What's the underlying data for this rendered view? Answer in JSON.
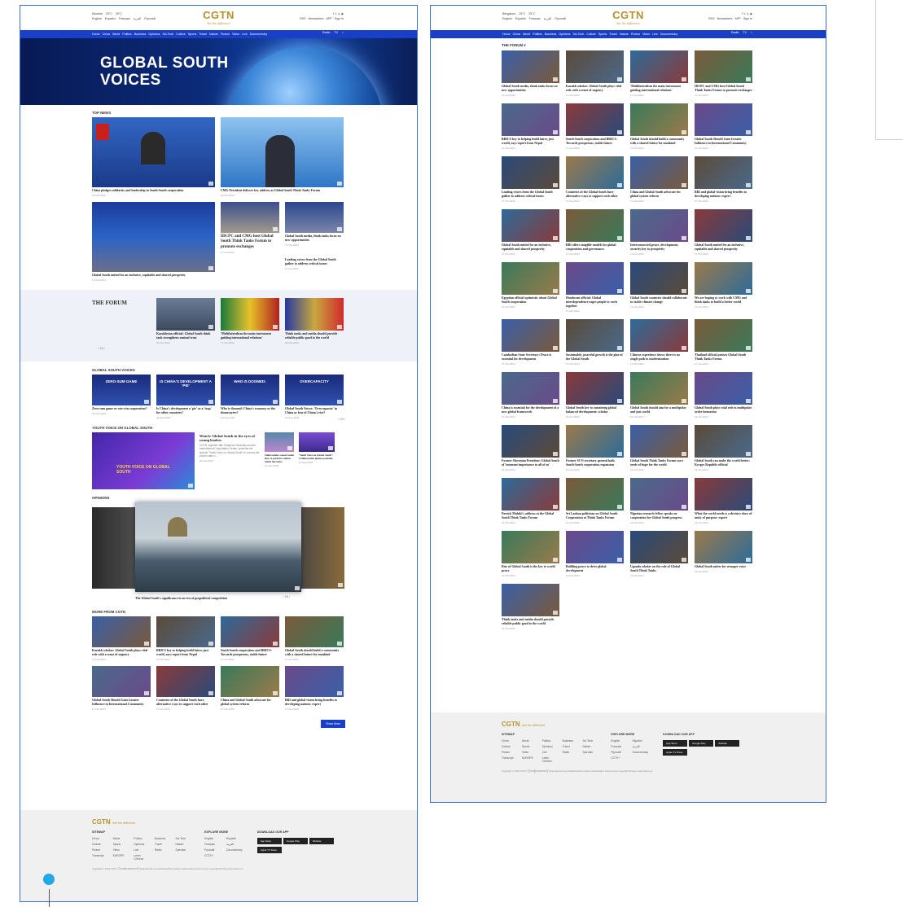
{
  "site": {
    "logo": "CGTN",
    "tagline": "See the difference",
    "weather_a": "Mumbai",
    "weather_b": "Bengaluru",
    "temp1": "25°C",
    "temp2": "25°C",
    "languages": [
      "English",
      "Español",
      "Français",
      "العربية",
      "Русский"
    ],
    "right": "RSS",
    "newsletter": "Newsletters",
    "apps": "APP",
    "login": "Sign In"
  },
  "nav": {
    "items": [
      "Home",
      "China",
      "World",
      "Politics",
      "Business",
      "Opinions",
      "Sci-Tech",
      "Culture",
      "Sports",
      "Travel",
      "Nature",
      "Picture",
      "Video",
      "Live",
      "Documentary"
    ],
    "radio": "Radio",
    "tv": "TV"
  },
  "hero": {
    "line1": "GLOBAL SOUTH",
    "line2": "VOICES"
  },
  "sections": {
    "top_news": "TOP NEWS",
    "forum": "THE FORUM",
    "voices": "GLOBAL SOUTH VOICES",
    "youth": "YOUTH VOICE ON GLOBAL SOUTH",
    "opinions": "OPINIONS",
    "more": "MORE FROM CGTN",
    "forum_b": "THE FORUM"
  },
  "top_news": [
    {
      "title": "China pledges solidarity and leadership in South-South cooperation",
      "date": "24-Oct-2024"
    },
    {
      "title": "CMG President delivers key address at Global South Think Tanks Forum",
      "date": "24-Oct-2024"
    },
    {
      "title": "Global South united for an inclusive, equitable and shared prosperity",
      "date": "17-Oct-2024"
    },
    {
      "title": "IDCPC and CMG host Global South Think Tanks Forum to promote exchanges",
      "date": "17-Oct-2024"
    },
    {
      "title": "Global South media, think tanks focus on new opportunities",
      "date": "17-Oct-2024"
    },
    {
      "title": "Leading voices from the Global South gather to address critical issues",
      "date": "17-Oct-2024"
    }
  ],
  "forum": [
    {
      "title": "Kazakhstan official: Global South think tank strengthens mutual trust",
      "date": "24-Oct-2024"
    },
    {
      "title": "'Multilateralism the main instrument guiding international relations'",
      "date": "17-Oct-2024"
    },
    {
      "title": "Think tanks and media should provide reliable public good to the world",
      "date": "24-Oct-2024"
    }
  ],
  "forum_pager": "1/4",
  "voices": [
    {
      "title": "Zero-sum game or win-win cooperation?",
      "date": "24-Sep-2024",
      "label": "ZERO-SUM GAME"
    },
    {
      "title": "Is China's development a 'pie' or a 'trap' for other countries?",
      "date": "24-Sep-2024",
      "label": "IS CHINA'S DEVELOPMENT A 'PIE'"
    },
    {
      "title": "Who is doomed: China's economy or the doomsayers?",
      "date": "23-Sep-2024",
      "label": "WHO IS DOOMED:"
    },
    {
      "title": "Global South Voices: 'Overcapacity' in China or fear of China's rise?",
      "date": "20-Sep-2024",
      "label": "OVERCAPACITY"
    }
  ],
  "voices_pager": "1/3",
  "youth": {
    "main_title": "Watch: Global South in the eyes of young leaders",
    "main_desc": "CGTN, together with Tsinghua University and the International Cooperation Center, presents the special \"Youth Voice on Global South\" to convey the youth's take o...",
    "main_date": "20-Sep-2024",
    "poster": "YOUTH VOICE ON GLOBAL SOUTH",
    "side": [
      {
        "title": "Stella tackles conservation flow to push for Global South narrative",
        "date": "13-Sep-2024"
      },
      {
        "title": "'Youth Voice on Global South': Collaboration ignites potential",
        "date": "13-Sep-2024"
      }
    ]
  },
  "opinions": {
    "title": "The Global South's significance in an era of geopolitical competition",
    "pager": "1/8"
  },
  "more": [
    {
      "title": "Kazakh scholar: Global South plays vital role with a sense of urgency",
      "date": "17-Oct-2024"
    },
    {
      "title": "BRICS key to helping build fairer, just world, says expert from Nepal",
      "date": "17-Oct-2024"
    },
    {
      "title": "South-South cooperation and BRICS: Towards prosperous, stable future",
      "date": "17-Oct-2024"
    },
    {
      "title": "Global South should build a community with a shared future for mankind",
      "date": "17-Oct-2024"
    },
    {
      "title": "Global South Should Gain Greater Influence in International Community",
      "date": "17-Oct-2024"
    },
    {
      "title": "Countries of the Global South have alternative ways to support each other",
      "date": "17-Oct-2024"
    },
    {
      "title": "China and Global South advocate for global system reform",
      "date": "17-Oct-2024"
    },
    {
      "title": "BRI and global vision bring benefits to developing nations: expert",
      "date": "17-Oct-2024"
    }
  ],
  "show_more": "Show More",
  "forum_list": [
    {
      "title": "Global South media, think tanks focus on new opportunities",
      "date": "17-Oct-2024"
    },
    {
      "title": "Kazakh scholar: Global South plays vital role with a sense of urgency",
      "date": "17-Oct-2024"
    },
    {
      "title": "'Multilateralism the main instrument guiding international relations'",
      "date": "17-Oct-2024"
    },
    {
      "title": "IDCPC and CMG host Global South Think Tanks Forum to promote exchanges",
      "date": "17-Oct-2024"
    },
    {
      "title": "BRICS key to helping build fairer, just world, says expert from Nepal",
      "date": "17-Oct-2024"
    },
    {
      "title": "South-South cooperation and BRICS: Towards prosperous, stable future",
      "date": "17-Oct-2024"
    },
    {
      "title": "Global South should build a community with a shared future for mankind",
      "date": "17-Oct-2024"
    },
    {
      "title": "Global South Should Gain Greater Influence in International Community",
      "date": "17-Oct-2024"
    },
    {
      "title": "Leading voices from the Global South gather to address critical issues",
      "date": "17-Oct-2024"
    },
    {
      "title": "Countries of the Global South have alternative ways to support each other",
      "date": "17-Oct-2024"
    },
    {
      "title": "China and Global South advocate for global system reform",
      "date": "17-Oct-2024"
    },
    {
      "title": "BRI and global vision bring benefits to developing nations: expert",
      "date": "17-Oct-2024"
    },
    {
      "title": "Global South united for an inclusive, equitable and shared prosperity",
      "date": "17-Oct-2024"
    },
    {
      "title": "BRI offers tangible models for global cooperation and governance",
      "date": "17-Oct-2024"
    },
    {
      "title": "Interconnected peace, development, security key to prosperity",
      "date": "17-Oct-2024"
    },
    {
      "title": "Global South united for an inclusive, equitable and shared prosperity",
      "date": "17-Oct-2024"
    },
    {
      "title": "Egyptian official optimistic about Global South cooperation",
      "date": "17-Oct-2024"
    },
    {
      "title": "Honduran official: Global interdependence urges people to work together",
      "date": "17-Oct-2024"
    },
    {
      "title": "Global South countries should collaborate to tackle climate change",
      "date": "17-Oct-2024"
    },
    {
      "title": "We are hoping to work with CMG and think tanks to build a better world",
      "date": "17-Oct-2024"
    },
    {
      "title": "Cambodian State Secretary: Peace is essential for development",
      "date": "17-Oct-2024"
    },
    {
      "title": "Sustainable, peaceful growth is the glue of the Global South",
      "date": "17-Oct-2024"
    },
    {
      "title": "Chinese experience shows there is no single path to modernization",
      "date": "17-Oct-2024"
    },
    {
      "title": "Thailand official praises Global South Think Tanks Forum",
      "date": "17-Oct-2024"
    },
    {
      "title": "China is essential for the development of a new global framework",
      "date": "17-Oct-2024"
    },
    {
      "title": "Global South key to sustaining global balanced development: scholar",
      "date": "16-Oct-2024"
    },
    {
      "title": "Global South should aim for a multipolar and just world",
      "date": "16-Oct-2024"
    },
    {
      "title": "Global South plays vital role in multipolar order formation",
      "date": "16-Oct-2024"
    },
    {
      "title": "Former Slovenian President: Global South of 'immense importance to all of us'",
      "date": "16-Oct-2024"
    },
    {
      "title": "Former SCO secretary general hails South-South cooperation expansion",
      "date": "16-Oct-2024"
    },
    {
      "title": "Global South Think Tanks Forum sows seeds of hope for the world",
      "date": "16-Oct-2024"
    },
    {
      "title": "Global South can make the world better: Kyrgyz Republic official",
      "date": "16-Oct-2024"
    },
    {
      "title": "Patrick Maluki's address at the Global South Think Tanks Forum",
      "date": "16-Oct-2024"
    },
    {
      "title": "Sri Lankan politician on Global South Cooperation at Think Tanks Forum",
      "date": "16-Oct-2024"
    },
    {
      "title": "Nigerian research fellow speaks on cooperation for Global South progress",
      "date": "16-Oct-2024"
    },
    {
      "title": "What the world needs is a decisive show of unity of purpose: expert",
      "date": "16-Oct-2024"
    },
    {
      "title": "Rise of Global South is the key to world peace",
      "date": "16-Oct-2024"
    },
    {
      "title": "Building peace to drive global development",
      "date": "16-Oct-2024"
    },
    {
      "title": "Uganda scholar on the role of Global South Think Tanks",
      "date": "16-Oct-2024"
    },
    {
      "title": "Global South unites for stronger voice",
      "date": "16-Oct-2024"
    },
    {
      "title": "Think tanks and media should provide reliable public good to the world",
      "date": "16-Oct-2024"
    }
  ],
  "footer": {
    "sitemap": "SITEMAP",
    "explore": "EXPLORE MORE",
    "download": "DOWNLOAD OUR APP",
    "sitemap_links": [
      "China",
      "World",
      "Politics",
      "Business",
      "Sci-Tech",
      "Culture",
      "Sports",
      "Opinions",
      "Travel",
      "Nature",
      "Picture",
      "Video",
      "Live",
      "Radio",
      "Specials",
      "Transcript",
      "EUROPE",
      "Learn Chinese"
    ],
    "explore_links": [
      "English",
      "Español",
      "Français",
      "العربية",
      "Русский",
      "Documentary",
      "CCTV+"
    ],
    "apps": [
      "App Store",
      "Google Play",
      "Website",
      "Apple TV Store"
    ],
    "copyright": "Copyright © 2024 CGTN. 京ICP备16065310号   Reproduction is prohibited without written authorization   Terms of use   Copyright   Privacy policy   About us"
  }
}
